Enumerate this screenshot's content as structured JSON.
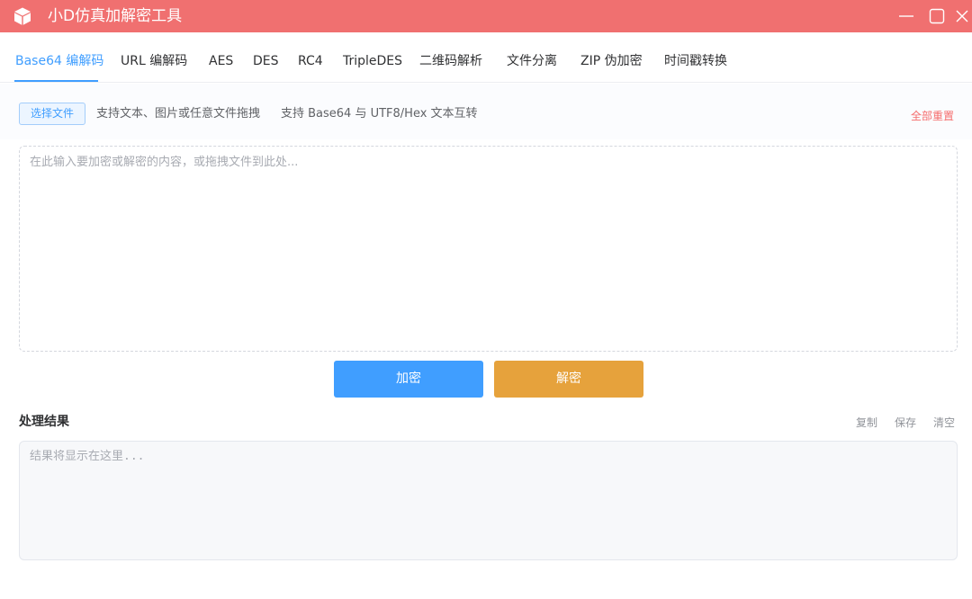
{
  "window": {
    "title": "小D仿真加解密工具",
    "icon": "cube-icon",
    "controls": [
      "minimize-icon",
      "maximize-icon",
      "close-icon"
    ],
    "accent_color": "#f07070"
  },
  "tabs": {
    "items": [
      {
        "label": "Base64 编解码",
        "active": true
      },
      {
        "label": "URL 编解码",
        "active": false
      },
      {
        "label": "AES",
        "active": false
      },
      {
        "label": "DES",
        "active": false
      },
      {
        "label": "RC4",
        "active": false
      },
      {
        "label": "TripleDES",
        "active": false
      },
      {
        "label": "二维码解析",
        "active": false
      },
      {
        "label": "文件分离",
        "active": false
      },
      {
        "label": "ZIP 伪加密",
        "active": false
      },
      {
        "label": "时间戳转换",
        "active": false
      }
    ],
    "active_color": "#409eff"
  },
  "toolbar": {
    "pick_file_label": "选择文件",
    "hint_file": "支持文本、图片或任意文件拖拽",
    "hint_convert": "支持 Base64 与 UTF8/Hex 文本互转",
    "reset_label": "全部重置"
  },
  "input": {
    "value": "",
    "placeholder": "在此输入要加密或解密的内容，或拖拽文件到此处..."
  },
  "actions": {
    "encrypt_label": "加密",
    "decrypt_label": "解密",
    "encrypt_color": "#409eff",
    "decrypt_color": "#e6a23c"
  },
  "result": {
    "title": "处理结果",
    "copy_label": "复制",
    "save_label": "保存",
    "clear_label": "清空",
    "value": "",
    "placeholder": "结果将显示在这里..."
  }
}
